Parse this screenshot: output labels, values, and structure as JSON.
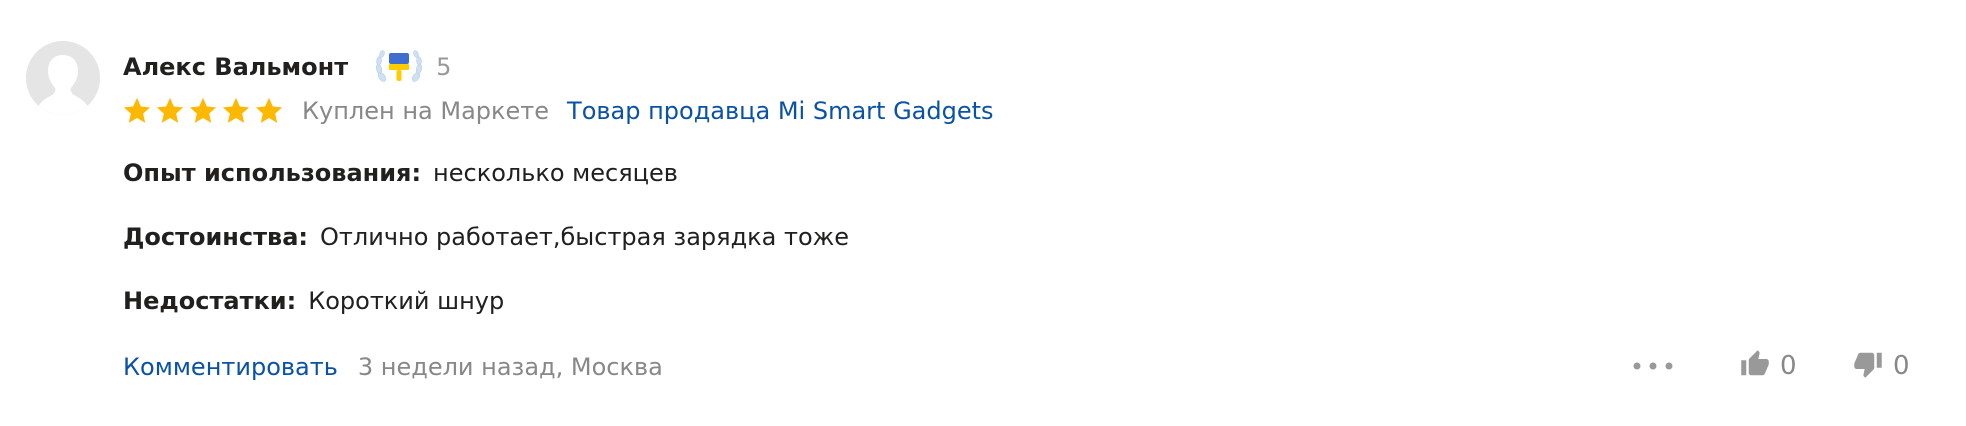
{
  "author": {
    "name": "Алекс Вальмонт",
    "badge_icon": "laurel-brush-badge-icon",
    "badge_count": "5",
    "avatar_icon": "default-avatar-icon"
  },
  "rating": {
    "stars": 5,
    "max": 5,
    "star_color": "#ffb800"
  },
  "meta": {
    "purchased_label": "Куплен на Маркете",
    "seller_link": "Товар продавца Mi Smart Gadgets"
  },
  "fields": {
    "experience": {
      "label": "Опыт использования:",
      "value": "несколько месяцев"
    },
    "pros": {
      "label": "Достоинства:",
      "value": "Отлично работает,быстрая зарядка тоже"
    },
    "cons": {
      "label": "Недостатки:",
      "value": "Короткий шнур"
    }
  },
  "footer": {
    "comment_label": "Комментировать",
    "date_city": "3 недели назад, Москва"
  },
  "actions": {
    "more_icon": "more-dots-icon",
    "likes": "0",
    "dislikes": "0"
  },
  "colors": {
    "link": "#0a52a6",
    "muted": "#888888",
    "text": "#21201f",
    "star": "#ffb800",
    "avatar_bg": "#e5e5e5"
  }
}
